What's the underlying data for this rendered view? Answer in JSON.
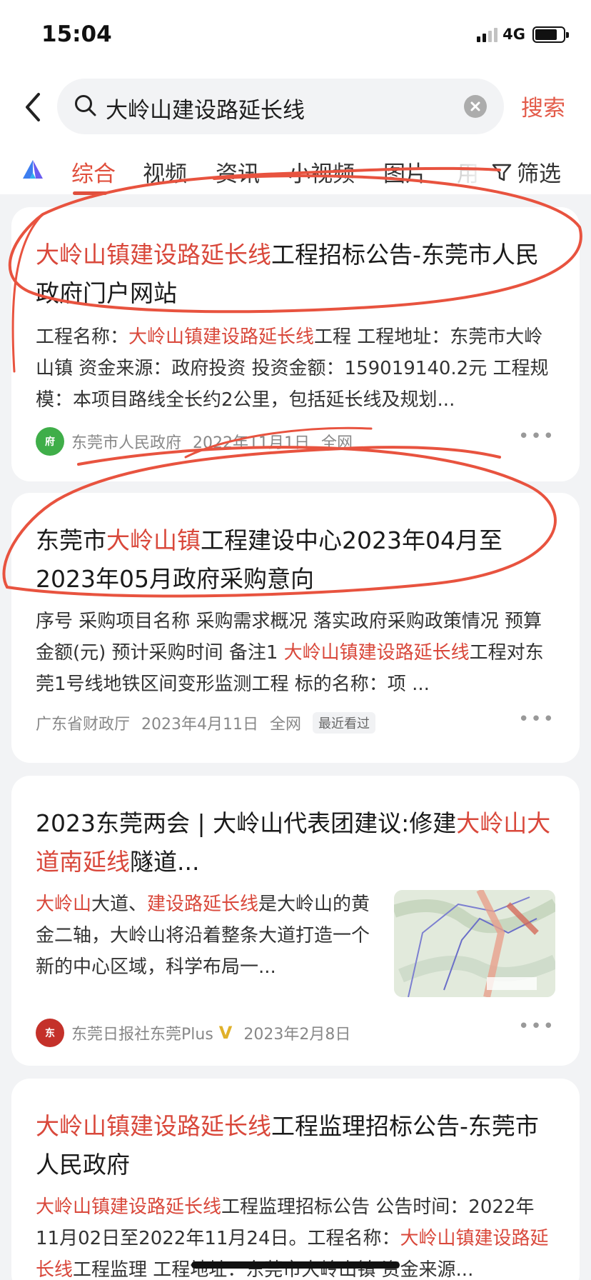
{
  "status": {
    "time": "15:04",
    "network": "4G"
  },
  "search": {
    "query": "大岭山建设路延长线",
    "button": "搜索"
  },
  "tabs": {
    "items": [
      "综合",
      "视频",
      "资讯",
      "小视频",
      "图片",
      "用"
    ],
    "active": 0,
    "filter": "筛选"
  },
  "results": [
    {
      "title": [
        {
          "t": "大岭山镇建设路延长线",
          "h": true
        },
        {
          "t": "工程招标公告-东莞市人民政府门户网站",
          "h": false
        }
      ],
      "snippet": [
        {
          "t": "工程名称：",
          "h": false
        },
        {
          "t": "大岭山镇建设路延长线",
          "h": true
        },
        {
          "t": "工程 工程地址：东莞市大岭山镇 资金来源：政府投资 投资金额：159019140.2元 工程规模：本项目路线全长约2公里，包括延长线及规划...",
          "h": false
        }
      ],
      "source": "东莞市人民政府",
      "date": "2022年11月1日",
      "scope": "全网"
    },
    {
      "title": [
        {
          "t": "东莞市",
          "h": false
        },
        {
          "t": "大岭山镇",
          "h": true
        },
        {
          "t": "工程建设中心2023年04月至2023年05月政府采购意向",
          "h": false
        }
      ],
      "snippet": [
        {
          "t": "序号 采购项目名称 采购需求概况 落实政府采购政策情况 预算金额(元) 预计采购时间 备注1 ",
          "h": false
        },
        {
          "t": "大岭山镇建设路延长线",
          "h": true
        },
        {
          "t": "工程对东莞1号线地铁区间变形监测工程 标的名称：项 ...",
          "h": false
        }
      ],
      "source": "广东省财政厅",
      "date": "2023年4月11日",
      "scope": "全网",
      "badge": "最近看过"
    },
    {
      "title": [
        {
          "t": "2023东莞两会 | 大岭山代表团建议:修建",
          "h": false
        },
        {
          "t": "大岭山大道南延线",
          "h": true
        },
        {
          "t": "隧道...",
          "h": false
        }
      ],
      "snippet": [
        {
          "t": "大岭山",
          "h": true
        },
        {
          "t": "大道、",
          "h": false
        },
        {
          "t": "建设路延长线",
          "h": true
        },
        {
          "t": "是大岭山的黄金二轴，大岭山将沿着整条大道打造一个新的中心区域，科学布局一...",
          "h": false
        }
      ],
      "source": "东莞日报社东莞Plus",
      "date": "2023年2月8日"
    },
    {
      "title": [
        {
          "t": "大岭山镇建设路延长线",
          "h": true
        },
        {
          "t": "工程监理招标公告-东莞市人民政府",
          "h": false
        }
      ],
      "snippet": [
        {
          "t": "大岭山镇建设路延长线",
          "h": true
        },
        {
          "t": "工程监理招标公告 公告时间：2022年11月02日至2022年11月24日。工程名称：",
          "h": false
        },
        {
          "t": "大岭山镇建设路延长线",
          "h": true
        },
        {
          "t": "工程监理 工程地址：东莞市大岭山镇 资金来源...",
          "h": false
        }
      ]
    }
  ],
  "colors": {
    "accent": "#e04f3d",
    "highlight": "#d9483b",
    "background": "#f2f3f5",
    "annotation": "#e8533f"
  }
}
